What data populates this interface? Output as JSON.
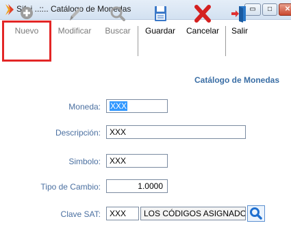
{
  "window": {
    "title": "Sifei ..::.. Catálogo de Monedas",
    "controls": {
      "minimize": "▭",
      "maximize": "□",
      "close": "✕"
    }
  },
  "toolbar": {
    "buttons": [
      {
        "label": "Nuevo",
        "icon": "plus-circle-icon",
        "enabled": false
      },
      {
        "label": "Modificar",
        "icon": "pencil-icon",
        "enabled": false
      },
      {
        "label": "Buscar",
        "icon": "magnifier-icon",
        "enabled": false
      },
      {
        "label": "Guardar",
        "icon": "floppy-disk-icon",
        "enabled": true
      },
      {
        "label": "Cancelar",
        "icon": "red-x-icon",
        "enabled": true
      },
      {
        "label": "Salir",
        "icon": "exit-door-icon",
        "enabled": true
      }
    ],
    "highlight_color": "#e32626"
  },
  "form": {
    "title": "Catálogo de Monedas",
    "fields": {
      "moneda": {
        "label": "Moneda:",
        "value": "XXX"
      },
      "descripcion": {
        "label": "Descripción:",
        "value": "XXX"
      },
      "simbolo": {
        "label": "Simbolo:",
        "value": "XXX"
      },
      "tipo_cambio": {
        "label": "Tipo de Cambio:",
        "value": "1.0000"
      },
      "clave_sat": {
        "label": "Clave SAT:",
        "code": "XXX",
        "description": "LOS CÓDIGOS ASIGNADO"
      }
    }
  },
  "colors": {
    "label_blue": "#4a6fa0",
    "title_blue": "#3a6ea5",
    "selection": "#3399ff"
  }
}
